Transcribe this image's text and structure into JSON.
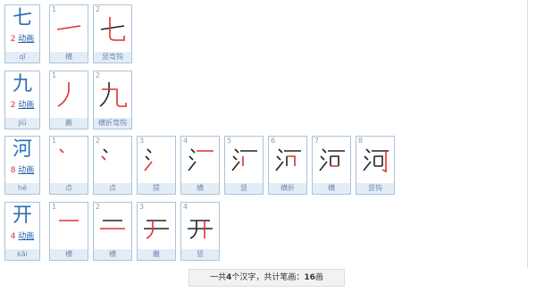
{
  "anim_label": "动画",
  "colors": {
    "old_stroke": "#222222",
    "new_stroke": "#e03030",
    "link": "#2a6fb8"
  },
  "chars": [
    {
      "char": "七",
      "count": "2",
      "pinyin": "qī",
      "strokes": [
        {
          "n": "1",
          "name": "横"
        },
        {
          "n": "2",
          "name": "竖弯钩"
        }
      ]
    },
    {
      "char": "九",
      "count": "2",
      "pinyin": "jiǔ",
      "strokes": [
        {
          "n": "1",
          "name": "撇"
        },
        {
          "n": "2",
          "name": "横折弯钩"
        }
      ]
    },
    {
      "char": "河",
      "count": "8",
      "pinyin": "hé",
      "strokes": [
        {
          "n": "1",
          "name": "点"
        },
        {
          "n": "2",
          "name": "点"
        },
        {
          "n": "3",
          "name": "提"
        },
        {
          "n": "4",
          "name": "横"
        },
        {
          "n": "5",
          "name": "竖"
        },
        {
          "n": "6",
          "name": "横折"
        },
        {
          "n": "7",
          "name": "横"
        },
        {
          "n": "8",
          "name": "竖钩"
        }
      ]
    },
    {
      "char": "开",
      "count": "4",
      "pinyin": "kāi",
      "strokes": [
        {
          "n": "1",
          "name": "横"
        },
        {
          "n": "2",
          "name": "横"
        },
        {
          "n": "3",
          "name": "撇"
        },
        {
          "n": "4",
          "name": "竖"
        }
      ]
    }
  ],
  "summary": {
    "prefix": "一共",
    "char_total": "4",
    "middle": "个汉字，共计笔画：",
    "stroke_total": "16",
    "suffix": "画"
  }
}
